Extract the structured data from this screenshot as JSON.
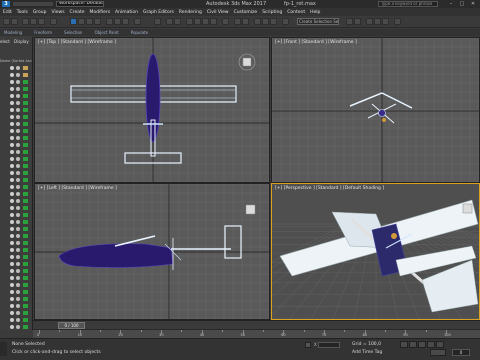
{
  "titlebar": {
    "logo": "3",
    "workspace": "Workspace: Default",
    "app_title": "Autodesk 3ds Max 2017",
    "file_title": "fp-1_rot.max",
    "search_placeholder": "Type a keyword or phrase",
    "minimize": "–",
    "maximize": "□",
    "close": "✕"
  },
  "menu": [
    "Edit",
    "Tools",
    "Group",
    "Views",
    "Create",
    "Modifiers",
    "Animation",
    "Graph Editors",
    "Rendering",
    "Civil View",
    "Customize",
    "Scripting",
    "Content",
    "Help"
  ],
  "toolbar": {
    "selection_set": "Create Selection Se"
  },
  "ribbon": [
    "Modeling",
    "Freeform",
    "Selection",
    "Object Paint",
    "Populate"
  ],
  "explorer": {
    "tab_select": "elect",
    "tab_display": "Display",
    "header": "Name (Sorted Ascen"
  },
  "viewports": {
    "top": "[+] [Top ] [Standard ] [Wireframe ]",
    "front": "[+] [Front ] [Standard ] [Wireframe ]",
    "left": "[+] [Left ] [Standard ] [Wireframe ]",
    "perspective": "[+] [Perspective ] [Standard ] [Default Shading ]"
  },
  "timeline": {
    "frame": "0 / 100",
    "ticks": [
      "0",
      "10",
      "20",
      "30",
      "40",
      "50",
      "60",
      "70",
      "80",
      "90",
      "100"
    ]
  },
  "status": {
    "selection": "None Selected",
    "prompt": "Click or click-and-drag to select objects",
    "grid": "Grid = 100,0",
    "add_time_tag": "Add Time Tag",
    "frame_value": "0"
  },
  "colors": {
    "viewport_bg": "#5a5a5a",
    "active_border": "#d9a320",
    "wire_blue": "#3a2a8a",
    "wire_white": "#e8f4ff",
    "wire_green": "#2ba23a"
  }
}
